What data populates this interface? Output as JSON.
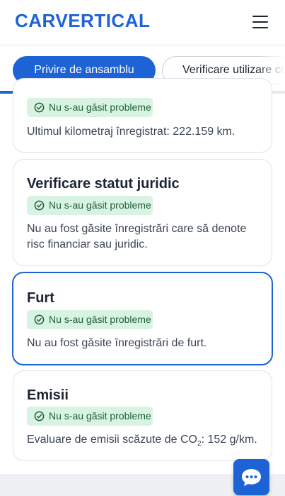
{
  "header": {
    "logo_text": "CARVERTICAL"
  },
  "tabs": [
    {
      "label": "Privire de ansamblu",
      "active": true
    },
    {
      "label": "Verificare utilizare comercială",
      "active": false
    }
  ],
  "progress": {
    "fraction": 0.05
  },
  "cards": [
    {
      "title": "",
      "badge": "Nu s-au găsit probleme",
      "description": "Ultimul kilometraj înregistrat: 222.159 km."
    },
    {
      "title": "Verificare statut juridic",
      "badge": "Nu s-au găsit probleme",
      "description": "Nu au fost găsite înregistrări care să denote risc financiar sau juridic."
    },
    {
      "title": "Furt",
      "badge": "Nu s-au găsit probleme",
      "description": "Nu au fost găsite înregistrări de furt."
    },
    {
      "title": "Emisii",
      "badge": "Nu s-au găsit probleme",
      "description_prefix": "Evaluare de emisii scăzute de CO",
      "description_sub": "2",
      "description_suffix": ": 152 g/km."
    }
  ],
  "colors": {
    "brand": "#1e63d6",
    "badge_bg": "#d9f3e2",
    "badge_text": "#1e5f3a"
  },
  "icons": {
    "menu": "hamburger-icon",
    "check": "check-circle-icon",
    "chat": "chat-bubble-icon"
  }
}
